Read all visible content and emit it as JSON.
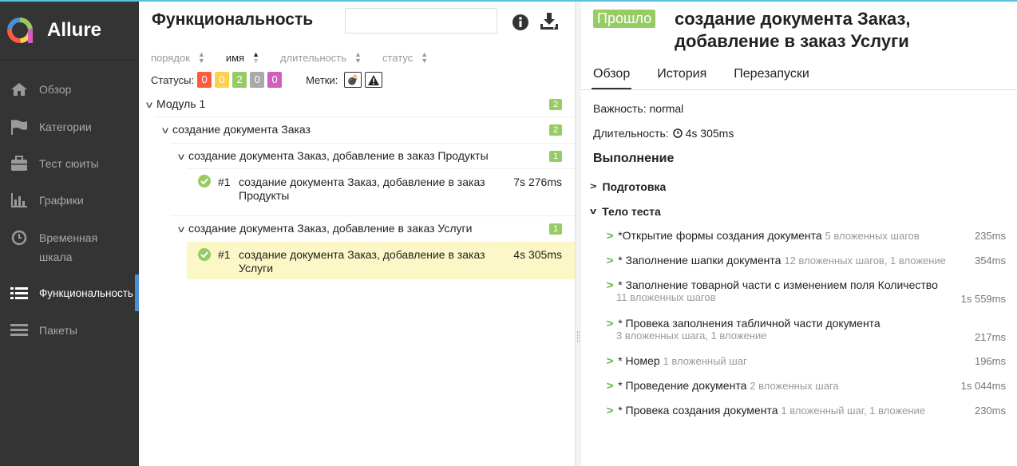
{
  "app": {
    "name": "Allure"
  },
  "sidebar": {
    "items": [
      {
        "label": "Обзор",
        "icon": "home-icon"
      },
      {
        "label": "Категории",
        "icon": "flag-icon"
      },
      {
        "label": "Тест сюиты",
        "icon": "briefcase-icon"
      },
      {
        "label": "Графики",
        "icon": "bar-chart-icon"
      },
      {
        "label": "Временная шкала",
        "icon": "clock-icon"
      },
      {
        "label": "Функциональность",
        "icon": "list-icon",
        "active": true
      },
      {
        "label": "Пакеты",
        "icon": "lines-icon"
      }
    ]
  },
  "left": {
    "title": "Функциональность",
    "search_placeholder": "",
    "sort": {
      "order": "порядок",
      "name": "имя",
      "duration": "длительность",
      "status": "статус"
    },
    "statuses_label": "Статусы:",
    "statuses": [
      {
        "value": "0",
        "color": "#fd5a3e"
      },
      {
        "value": "0",
        "color": "#ffd050"
      },
      {
        "value": "2",
        "color": "#97cc64"
      },
      {
        "value": "0",
        "color": "#aaaaaa"
      },
      {
        "value": "0",
        "color": "#d35ebe"
      }
    ],
    "marks_label": "Метки:",
    "tree": {
      "module": {
        "label": "Модуль 1",
        "count": "2"
      },
      "feature": {
        "label": "создание документа Заказ",
        "count": "2"
      },
      "story1": {
        "label": "создание документа Заказ, добавление в заказ Продукты",
        "count": "1"
      },
      "test1": {
        "num": "#1",
        "label": "создание документа Заказ, добавление в заказ Продукты",
        "duration": "7s 276ms"
      },
      "story2": {
        "label": "создание документа Заказ, добавление в заказ Услуги",
        "count": "1"
      },
      "test2": {
        "num": "#1",
        "label": "создание документа Заказ, добавление в заказ Услуги",
        "duration": "4s 305ms"
      }
    }
  },
  "right": {
    "status_badge": "Прошло",
    "title": "создание документа Заказ, добавление в заказ Услуги",
    "tabs": [
      "Обзор",
      "История",
      "Перезапуски"
    ],
    "severity": "Важность: normal",
    "duration_label": "Длительность:",
    "duration_value": "4s 305ms",
    "execution_heading": "Выполнение",
    "setup_label": "Подготовка",
    "body_label": "Тело теста",
    "steps": [
      {
        "name": "*Открытие формы создания документа",
        "sub": "5 вложенных шагов",
        "duration": "235ms"
      },
      {
        "name": "* Заполнение шапки документа",
        "sub": "12 вложенных шагов, 1 вложение",
        "duration": "354ms"
      },
      {
        "name": "* Заполнение товарной части с изменением поля Количество",
        "sub": "11 вложенных шагов",
        "duration": "1s 559ms"
      },
      {
        "name": "* Провека заполнения табличной части документа",
        "sub": "3 вложенных шага, 1 вложение",
        "duration": "217ms"
      },
      {
        "name": "* Номер",
        "sub": "1 вложенный шаг",
        "duration": "196ms"
      },
      {
        "name": "* Проведение документа",
        "sub": "2 вложенных шага",
        "duration": "1s 044ms"
      },
      {
        "name": "* Провека создания документа",
        "sub": "1 вложенный шаг, 1 вложение",
        "duration": "230ms"
      }
    ]
  }
}
